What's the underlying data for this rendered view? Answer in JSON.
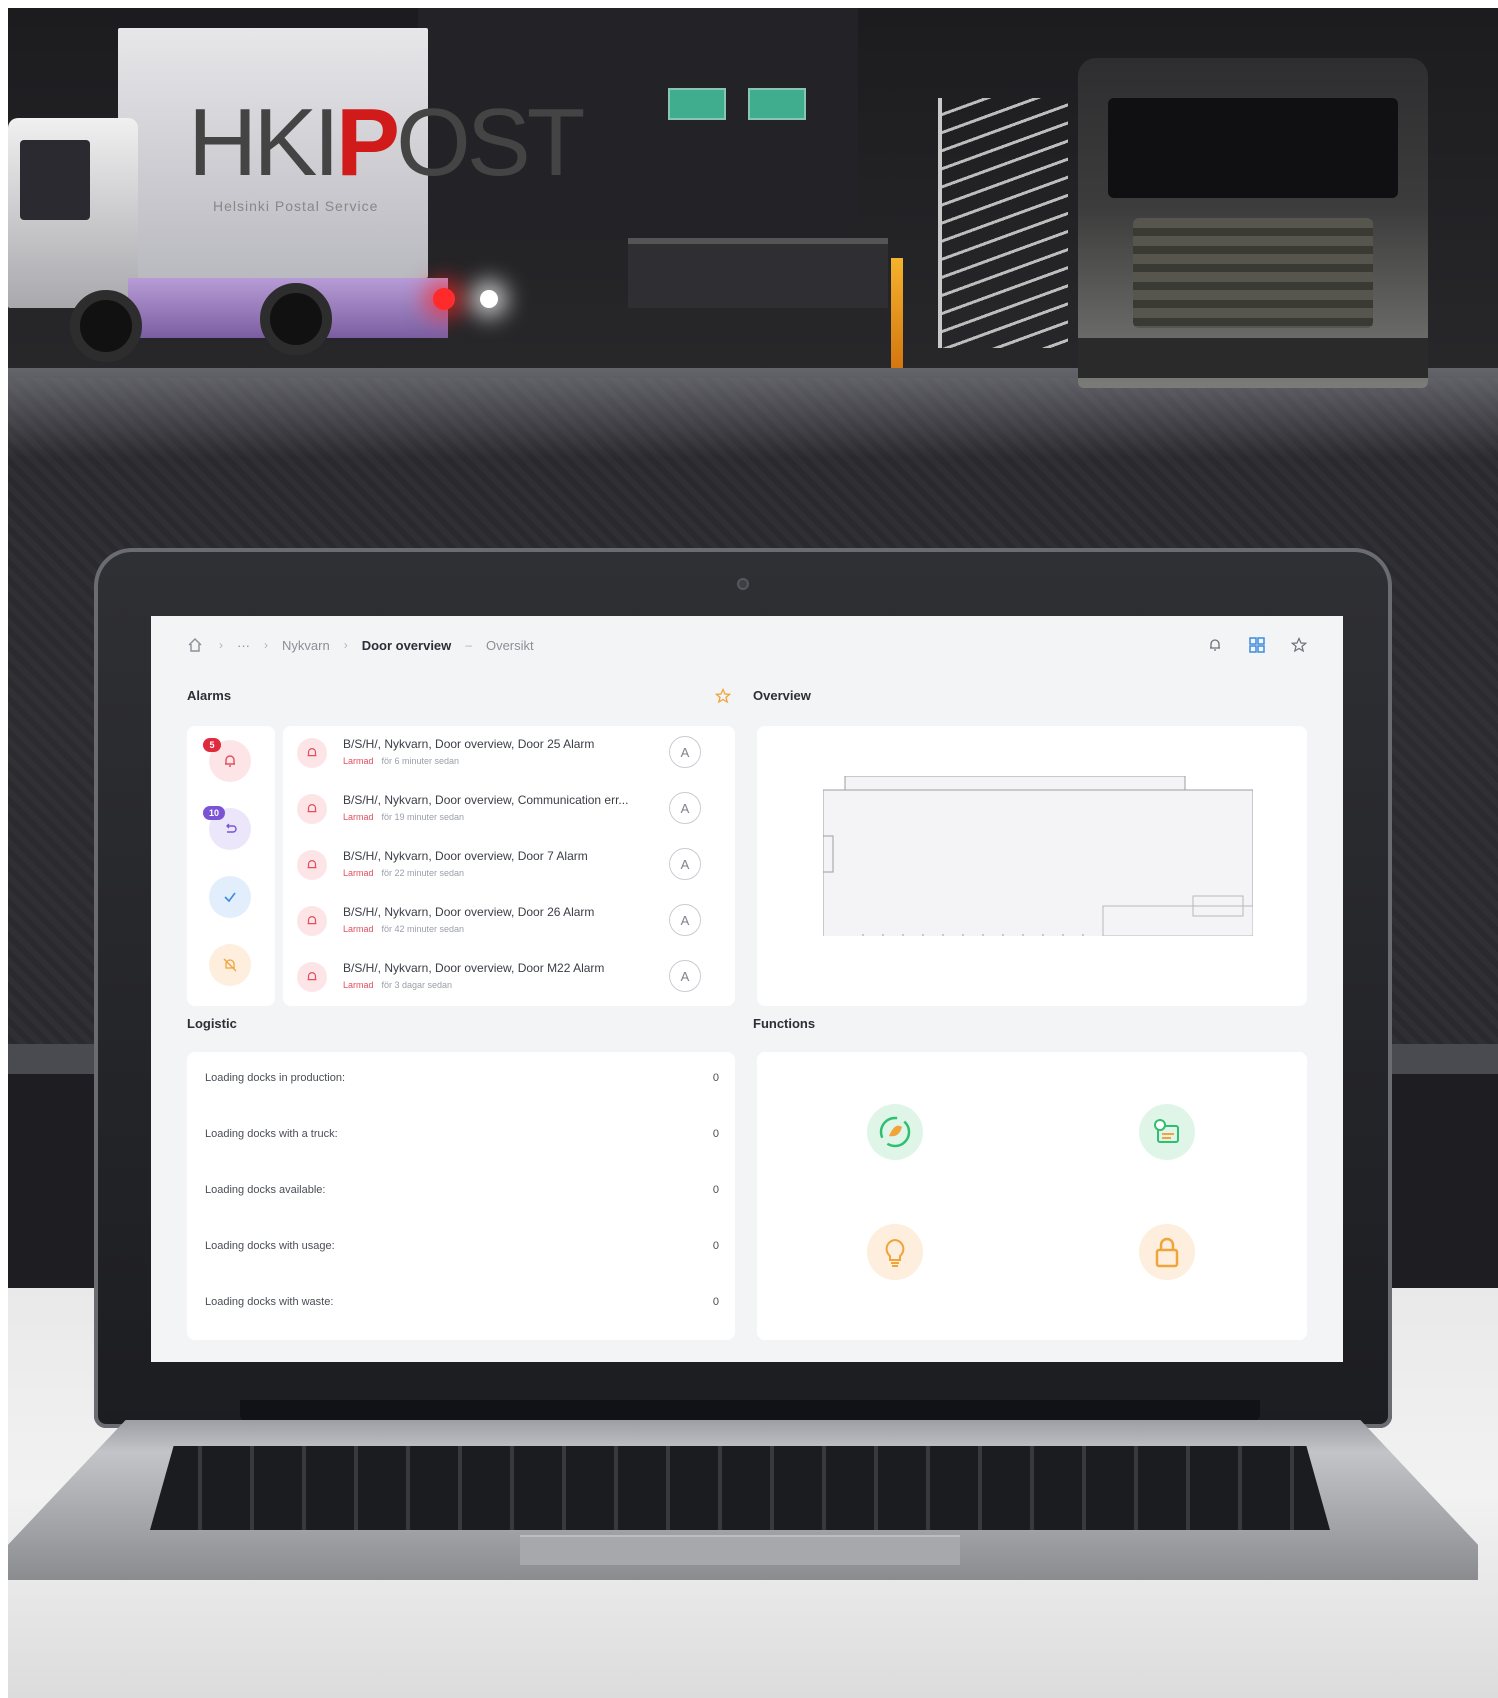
{
  "photo": {
    "truck_logo": "HKI",
    "truck_logo_mark": "P",
    "truck_logo_tail": "OST",
    "truck_logo_sub": "Helsinki Postal Service"
  },
  "breadcrumb": {
    "home_icon": "home-icon",
    "ellipsis": "···",
    "site": "Nykvarn",
    "page": "Door overview",
    "view": "Oversikt"
  },
  "topbar": {
    "icons": [
      "bell-icon",
      "grid-icon",
      "star-icon"
    ]
  },
  "alarms": {
    "title": "Alarms",
    "favorite_icon": "star-icon",
    "side": [
      {
        "icon": "bell-icon",
        "badge": "5",
        "bg": "#fde4e7",
        "badge_color": "#e02a3e"
      },
      {
        "icon": "undo-icon",
        "badge": "10",
        "bg": "#ece6fb",
        "badge_color": "#7b54d6"
      },
      {
        "icon": "check-icon",
        "badge": "",
        "bg": "#e2eefc",
        "badge_color": ""
      },
      {
        "icon": "mute-icon",
        "badge": "",
        "bg": "#fdeede",
        "badge_color": ""
      }
    ],
    "items": [
      {
        "title": "B/S/H/, Nykvarn, Door overview, Door 25 Alarm",
        "status": "Larmad",
        "time": "för 6 minuter sedan",
        "ack": "A"
      },
      {
        "title": "B/S/H/, Nykvarn, Door overview, Communication err...",
        "status": "Larmad",
        "time": "för 19 minuter sedan",
        "ack": "A"
      },
      {
        "title": "B/S/H/, Nykvarn, Door overview, Door 7 Alarm",
        "status": "Larmad",
        "time": "för 22 minuter sedan",
        "ack": "A"
      },
      {
        "title": "B/S/H/, Nykvarn, Door overview, Door 26 Alarm",
        "status": "Larmad",
        "time": "för 42 minuter sedan",
        "ack": "A"
      },
      {
        "title": "B/S/H/, Nykvarn, Door overview, Door M22 Alarm",
        "status": "Larmad",
        "time": "för 3 dagar sedan",
        "ack": "A"
      }
    ]
  },
  "overview": {
    "title": "Overview"
  },
  "logistic": {
    "title": "Logistic",
    "rows": [
      {
        "label": "Loading docks in production:",
        "value": "0"
      },
      {
        "label": "Loading docks with a truck:",
        "value": "0"
      },
      {
        "label": "Loading docks available:",
        "value": "0"
      },
      {
        "label": "Loading docks with usage:",
        "value": "0"
      },
      {
        "label": "Loading docks with waste:",
        "value": "0"
      }
    ]
  },
  "functions": {
    "title": "Functions",
    "items": [
      {
        "icon": "energy-cycle-icon",
        "color": "#2fbf71"
      },
      {
        "icon": "schedule-icon",
        "color": "#2fbf71"
      },
      {
        "icon": "lightbulb-icon",
        "color": "#f0a43a"
      },
      {
        "icon": "lock-icon",
        "color": "#f0a43a"
      }
    ]
  }
}
